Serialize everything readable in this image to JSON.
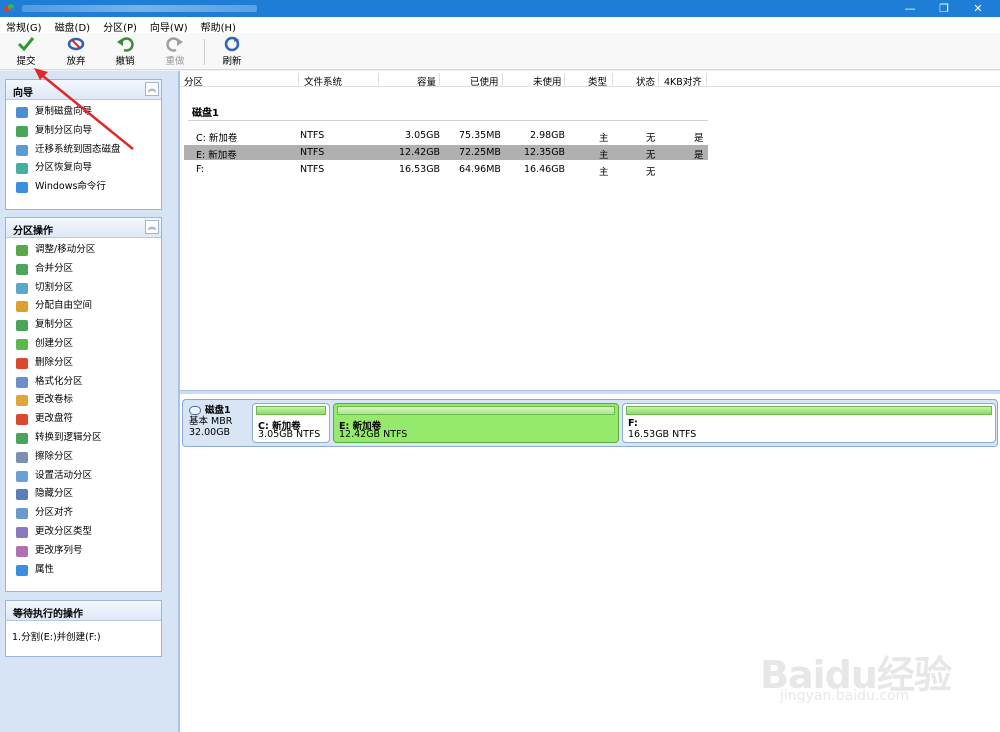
{
  "window": {
    "min_label": "—",
    "max_label": "❐",
    "close_label": "✕"
  },
  "menu": [
    {
      "label": "常规(G)"
    },
    {
      "label": "磁盘(D)"
    },
    {
      "label": "分区(P)"
    },
    {
      "label": "向导(W)"
    },
    {
      "label": "帮助(H)"
    }
  ],
  "toolbar": {
    "commit": {
      "label": "提交",
      "icon": "check-icon",
      "color": "#2e9a2e"
    },
    "discard": {
      "label": "放弃",
      "icon": "discard-icon",
      "color": "#2c62b8"
    },
    "undo": {
      "label": "撤销",
      "icon": "undo-icon",
      "color": "#3a8a3a"
    },
    "redo": {
      "label": "重做",
      "icon": "redo-icon",
      "color": "#9a9a9a"
    },
    "refresh": {
      "label": "刷新",
      "icon": "refresh-icon",
      "color": "#2c62b8"
    }
  },
  "wizard_panel": {
    "title": "向导",
    "items": [
      {
        "label": "复制磁盘向导"
      },
      {
        "label": "复制分区向导"
      },
      {
        "label": "迁移系统到固态磁盘"
      },
      {
        "label": "分区恢复向导"
      },
      {
        "label": "Windows命令行"
      }
    ]
  },
  "ops_panel": {
    "title": "分区操作",
    "items": [
      {
        "label": "调整/移动分区"
      },
      {
        "label": "合并分区"
      },
      {
        "label": "切割分区"
      },
      {
        "label": "分配自由空间"
      },
      {
        "label": "复制分区"
      },
      {
        "label": "创建分区"
      },
      {
        "label": "删除分区"
      },
      {
        "label": "格式化分区"
      },
      {
        "label": "更改卷标"
      },
      {
        "label": "更改盘符"
      },
      {
        "label": "转换到逻辑分区"
      },
      {
        "label": "擦除分区"
      },
      {
        "label": "设置活动分区"
      },
      {
        "label": "隐藏分区"
      },
      {
        "label": "分区对齐"
      },
      {
        "label": "更改分区类型"
      },
      {
        "label": "更改序列号"
      },
      {
        "label": "属性"
      }
    ]
  },
  "pending_panel": {
    "title": "等待执行的操作",
    "items": [
      {
        "label": "1.分割(E:)并创建(F:)"
      }
    ]
  },
  "table": {
    "columns": [
      "分区",
      "文件系统",
      "容量",
      "已使用",
      "未使用",
      "类型",
      "状态",
      "4KB对齐"
    ],
    "disk_label": "磁盘1",
    "rows": [
      {
        "partition": "C: 新加卷",
        "fs": "NTFS",
        "capacity": "3.05GB",
        "used": "75.35MB",
        "free": "2.98GB",
        "type": "主",
        "status": "无",
        "aligned": "是"
      },
      {
        "partition": "E: 新加卷",
        "fs": "NTFS",
        "capacity": "12.42GB",
        "used": "72.25MB",
        "free": "12.35GB",
        "type": "主",
        "status": "无",
        "aligned": "是",
        "selected": true
      },
      {
        "partition": "F:",
        "fs": "NTFS",
        "capacity": "16.53GB",
        "used": "64.96MB",
        "free": "16.46GB",
        "type": "主",
        "status": "无",
        "aligned": ""
      }
    ]
  },
  "disk_map": {
    "name": "磁盘1",
    "kind": "基本 MBR",
    "size": "32.00GB",
    "partitions": [
      {
        "name": "C: 新加卷",
        "desc": "3.05GB NTFS"
      },
      {
        "name": "E: 新加卷",
        "desc": "12.42GB NTFS"
      },
      {
        "name": "F:",
        "desc": "16.53GB NTFS"
      }
    ]
  },
  "watermark": {
    "main": "Baidu经验",
    "sub": "jingyan.baidu.com"
  },
  "colors": {
    "accent": "#1e7ed6",
    "selected_partition": "#95ea6b",
    "arrow": "#e0282a"
  }
}
